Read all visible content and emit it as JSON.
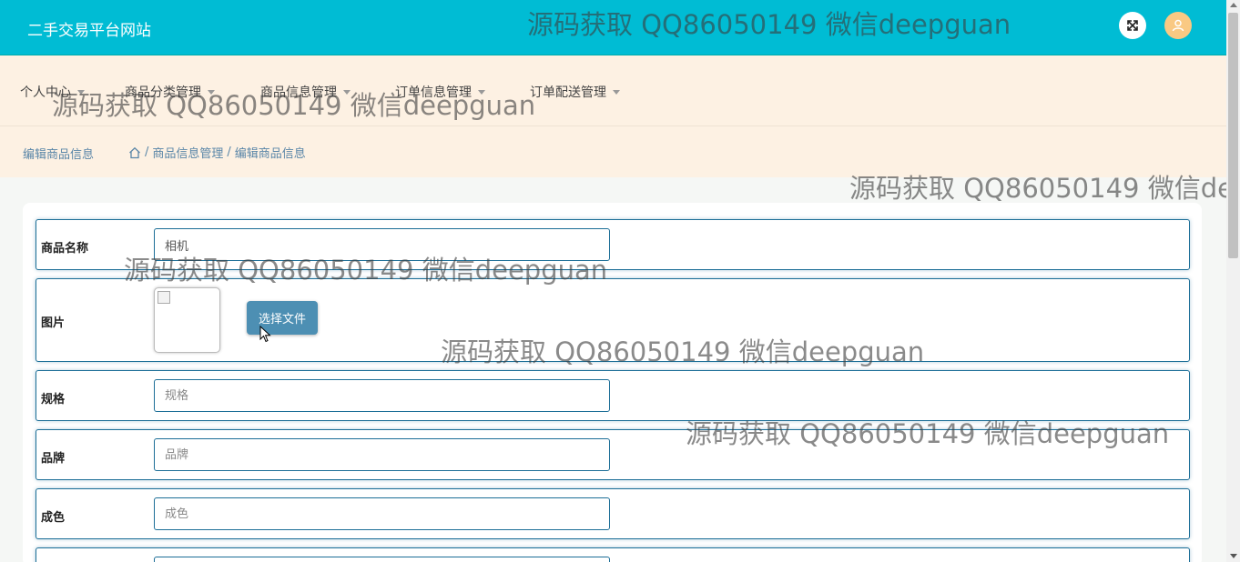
{
  "header": {
    "app_title": "二手交易平台网站"
  },
  "nav": [
    {
      "label": "个人中心"
    },
    {
      "label": "商品分类管理"
    },
    {
      "label": "商品信息管理"
    },
    {
      "label": "订单信息管理"
    },
    {
      "label": "订单配送管理"
    }
  ],
  "breadcrumb": {
    "page_title": "编辑商品信息",
    "separator": "/",
    "items": [
      "商品信息管理",
      "编辑商品信息"
    ]
  },
  "form": {
    "name": {
      "label": "商品名称",
      "value": "相机"
    },
    "image": {
      "label": "图片",
      "button": "选择文件"
    },
    "spec": {
      "label": "规格",
      "placeholder": "规格"
    },
    "brand": {
      "label": "品牌",
      "placeholder": "品牌"
    },
    "condition": {
      "label": "成色",
      "placeholder": "成色"
    }
  },
  "watermark_text": "源码获取 QQ86050149 微信deepguan",
  "colors": {
    "header_bg": "#00bcd4",
    "nav_bg": "#fdf1e3",
    "accent": "#1c6e97",
    "button": "#4d8fb3"
  }
}
